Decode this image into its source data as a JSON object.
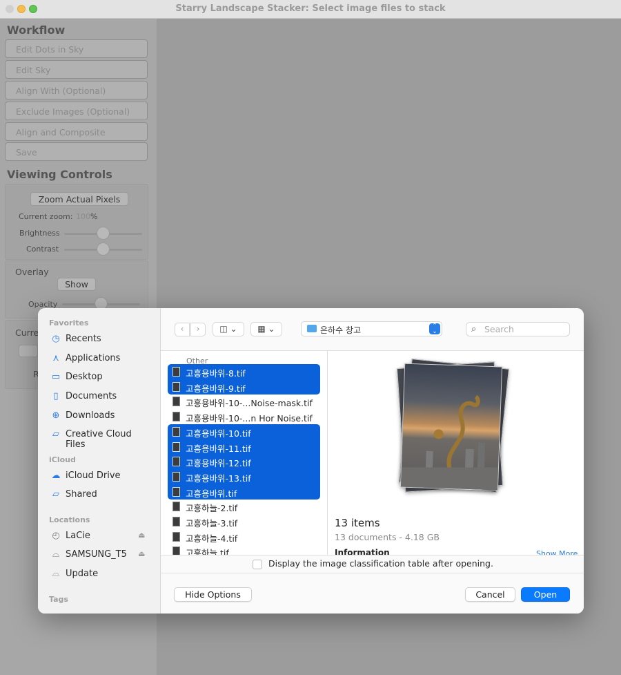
{
  "window": {
    "title": "Starry Landscape Stacker: Select image files to stack"
  },
  "sidebar": {
    "workflow_title": "Workflow",
    "workflow_buttons": [
      "Edit Dots in Sky",
      "Edit Sky",
      "Align With (Optional)",
      "Exclude Images (Optional)",
      "Align and Composite",
      "Save"
    ],
    "viewing_title": "Viewing Controls",
    "zoom_button": "Zoom Actual Pixels",
    "current_zoom_label": "Current zoom:",
    "current_zoom_value": "100",
    "current_zoom_unit": "%",
    "brightness_label": "Brightness",
    "brightness_level": 0.5,
    "contrast_label": "Contrast",
    "contrast_level": 0.5,
    "overlay_label": "Overlay",
    "overlay_button": "Show",
    "opacity_label": "Opacity",
    "opacity_level": 0.5,
    "current_partial": "Curre",
    "partial_letter": "R"
  },
  "dialog": {
    "favorites_head": "Favorites",
    "favorites": [
      {
        "icon": "clock-icon",
        "label": "Recents"
      },
      {
        "icon": "applications-icon",
        "label": "Applications"
      },
      {
        "icon": "desktop-icon",
        "label": "Desktop"
      },
      {
        "icon": "document-icon",
        "label": "Documents"
      },
      {
        "icon": "download-icon",
        "label": "Downloads"
      },
      {
        "icon": "folder-icon",
        "label": "Creative Cloud Files"
      }
    ],
    "icloud_head": "iCloud",
    "icloud": [
      {
        "icon": "cloud-icon",
        "label": "iCloud Drive"
      },
      {
        "icon": "shared-folder-icon",
        "label": "Shared"
      }
    ],
    "locations_head": "Locations",
    "locations": [
      {
        "icon": "time-machine-icon",
        "label": "LaCie",
        "eject": true
      },
      {
        "icon": "drive-icon",
        "label": "SAMSUNG_T5",
        "eject": true
      },
      {
        "icon": "drive-icon",
        "label": "Update",
        "eject": false
      }
    ],
    "tags_head": "Tags",
    "path_label": "은하수 창고",
    "search_placeholder": "Search",
    "file_list_head": "Other",
    "files": [
      {
        "name": "고흥용바위-8.tif",
        "selected": true
      },
      {
        "name": "고흥용바위-9.tif",
        "selected": true
      },
      {
        "name": "고흥용바위-10-...Noise-mask.tif",
        "selected": false
      },
      {
        "name": "고흥용바위-10-...n Hor Noise.tif",
        "selected": false
      },
      {
        "name": "고흥용바위-10.tif",
        "selected": true
      },
      {
        "name": "고흥용바위-11.tif",
        "selected": true
      },
      {
        "name": "고흥용바위-12.tif",
        "selected": true
      },
      {
        "name": "고흥용바위-13.tif",
        "selected": true
      },
      {
        "name": "고흥용바위.tif",
        "selected": true
      },
      {
        "name": "고흥하늘-2.tif",
        "selected": false
      },
      {
        "name": "고흥하늘-3.tif",
        "selected": false
      },
      {
        "name": "고흥하늘-4.tif",
        "selected": false
      },
      {
        "name": "고흥하늘.tif",
        "selected": false
      }
    ],
    "preview_count": "13 items",
    "preview_sub": "13 documents - 4.18 GB",
    "preview_info": "Information",
    "preview_more": "Show More",
    "checkbox_label": "Display the image classification table after opening.",
    "checkbox_checked": false,
    "hide_options": "Hide Options",
    "cancel": "Cancel",
    "open": "Open"
  },
  "colors": {
    "selection": "#0a61d9",
    "primary_button": "#0a7aff",
    "accent_icon": "#2b7de3"
  }
}
